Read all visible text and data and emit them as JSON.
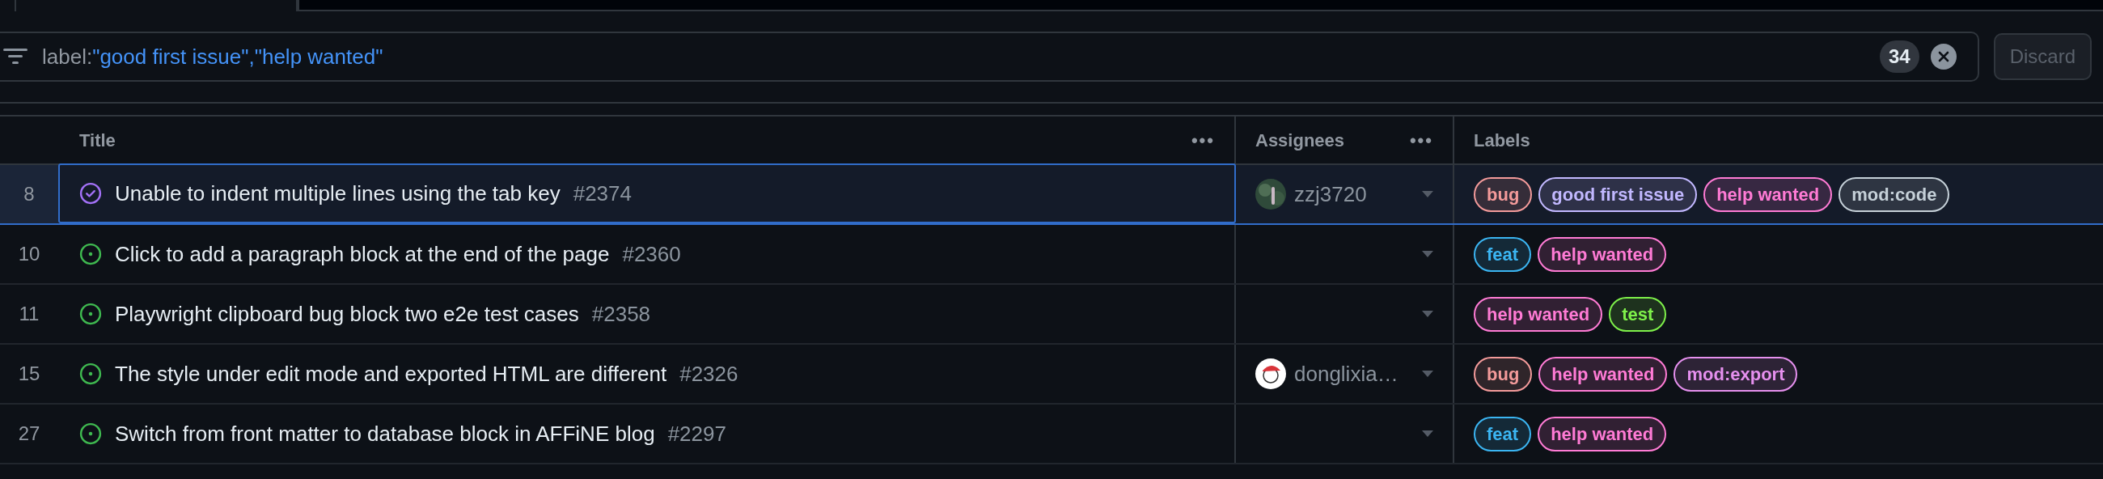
{
  "filter": {
    "key": "label:",
    "value": "\"good first issue\",\"help wanted\"",
    "count": "34",
    "discard": "Discard"
  },
  "table": {
    "columns": [
      {
        "label": "Title",
        "menu": "•••"
      },
      {
        "label": "Assignees",
        "menu": "•••"
      },
      {
        "label": "Labels"
      }
    ],
    "rows": [
      {
        "number": "8",
        "closed": true,
        "selected": true,
        "title": "Unable to indent multiple lines using the tab key",
        "issue": "#2374",
        "assignee": {
          "name": "zzj3720",
          "kind": "photo"
        },
        "labels": [
          {
            "text": "bug",
            "color": "#f39a9a"
          },
          {
            "text": "good first issue",
            "color": "#c2b8ff"
          },
          {
            "text": "help wanted",
            "color": "#ff7bd5"
          },
          {
            "text": "mod:code",
            "color": "#c5d0d8"
          }
        ]
      },
      {
        "number": "10",
        "closed": false,
        "selected": false,
        "title": "Click to add a paragraph block at the end of the page",
        "issue": "#2360",
        "labels": [
          {
            "text": "feat",
            "color": "#3bb5f2"
          },
          {
            "text": "help wanted",
            "color": "#ff7bd5"
          }
        ]
      },
      {
        "number": "11",
        "closed": false,
        "selected": false,
        "title": "Playwright clipboard bug block two e2e test cases",
        "issue": "#2358",
        "labels": [
          {
            "text": "help wanted",
            "color": "#ff7bd5"
          },
          {
            "text": "test",
            "color": "#7ef04a"
          }
        ]
      },
      {
        "number": "15",
        "closed": false,
        "selected": false,
        "title": "The style under edit mode and exported HTML are different",
        "issue": "#2326",
        "assignee": {
          "name": "donglixia…",
          "kind": "cartoon"
        },
        "labels": [
          {
            "text": "bug",
            "color": "#f39a9a"
          },
          {
            "text": "help wanted",
            "color": "#ff7bd5"
          },
          {
            "text": "mod:export",
            "color": "#e590ee"
          }
        ]
      },
      {
        "number": "27",
        "closed": false,
        "selected": false,
        "title": "Switch from front matter to database block in AFFiNE blog",
        "issue": "#2297",
        "labels": [
          {
            "text": "feat",
            "color": "#3bb5f2"
          },
          {
            "text": "help wanted",
            "color": "#ff7bd5"
          }
        ]
      }
    ]
  }
}
